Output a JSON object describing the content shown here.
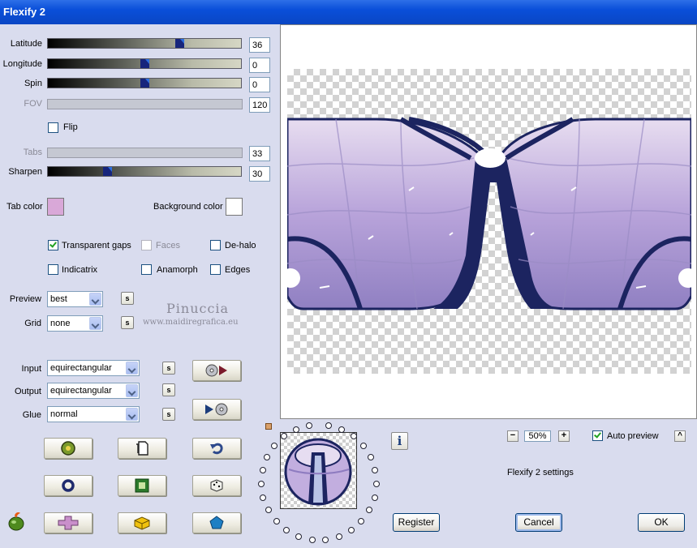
{
  "window": {
    "title": "Flexify 2"
  },
  "sliders": {
    "latitude": {
      "label": "Latitude",
      "value": "36",
      "level": 0.69
    },
    "longitude": {
      "label": "Longitude",
      "value": "0",
      "level": 0.5
    },
    "spin": {
      "label": "Spin",
      "value": "0",
      "level": 0.5
    },
    "fov": {
      "label": "FOV",
      "value": "120"
    },
    "tabs": {
      "label": "Tabs",
      "value": "33"
    },
    "sharpen": {
      "label": "Sharpen",
      "value": "30",
      "level": 0.3
    }
  },
  "flip": {
    "label": "Flip",
    "checked": false
  },
  "colors": {
    "tab_color_label": "Tab color",
    "tab_color": "#D9A8D8",
    "background_color_label": "Background color",
    "background_color": "#FFFFFF"
  },
  "options": {
    "transparent_gaps": {
      "label": "Transparent gaps",
      "checked": true
    },
    "faces": {
      "label": "Faces",
      "checked": false
    },
    "de_halo": {
      "label": "De-halo",
      "checked": false
    },
    "indicatrix": {
      "label": "Indicatrix",
      "checked": false
    },
    "anamorph": {
      "label": "Anamorph",
      "checked": false
    },
    "edges": {
      "label": "Edges",
      "checked": false
    }
  },
  "selects": {
    "preview": {
      "label": "Preview",
      "value": "best"
    },
    "grid": {
      "label": "Grid",
      "value": "none"
    },
    "input": {
      "label": "Input",
      "value": "equirectangular"
    },
    "output": {
      "label": "Output",
      "value": "equirectangular"
    },
    "glue": {
      "label": "Glue",
      "value": "normal"
    }
  },
  "s_label": "s",
  "watermark": {
    "name": "Pinuccia",
    "url": "www.maidiregrafica.eu"
  },
  "zoom": {
    "level": "50%",
    "minus": "−",
    "plus": "+"
  },
  "auto_preview": {
    "label": "Auto preview",
    "checked": true
  },
  "collapse_label": "^",
  "info_label": "i",
  "settings_label": "Flexify 2 settings",
  "buttons": {
    "register": "Register",
    "cancel": "Cancel",
    "ok": "OK"
  },
  "accent": {
    "purple": "#8F7FC4",
    "navy": "#1C2460",
    "lavender": "#C8B9E2"
  }
}
